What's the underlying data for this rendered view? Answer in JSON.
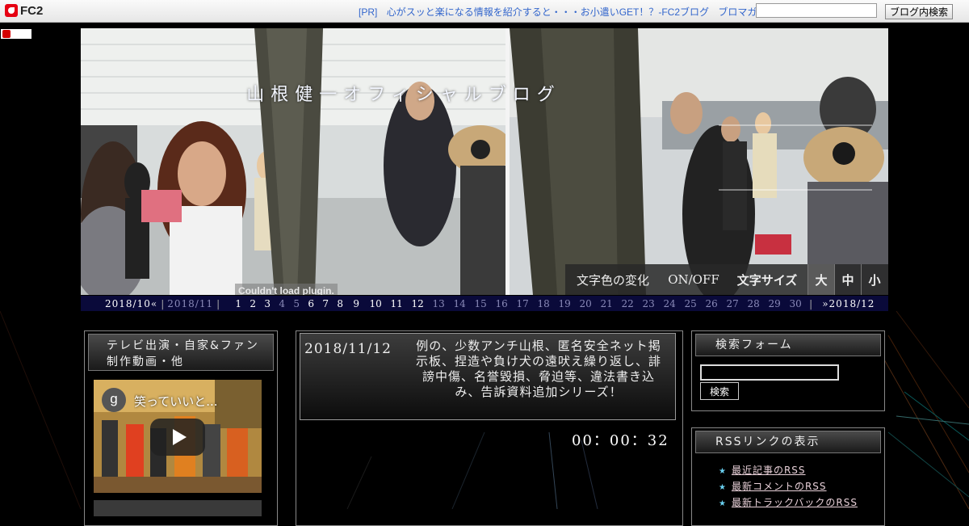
{
  "topbar": {
    "logo": "FC2",
    "pr_tag": "[PR]",
    "pr_text": "心がスッと楽になる情報を紹介すると・・・お小遣いGET！？-FC2ブログ",
    "promaga": "ブロマガ",
    "search_placeholder": "",
    "search_button": "ブログ内検索"
  },
  "header": {
    "blog_title": "山根健一オフィシャルブログ",
    "plugin_error": "Couldn't load plugin.",
    "color_change": "文字色の変化",
    "onoff": "ON/OFF",
    "font_size_label": "文字サイズ",
    "size_large": "大",
    "size_medium": "中",
    "size_small": "小"
  },
  "calendar": {
    "prev": "2018/10«",
    "current": "2018/11",
    "days_with_posts": [
      1,
      2,
      3,
      6,
      7,
      8,
      9,
      10,
      11,
      12
    ],
    "days": [
      1,
      2,
      3,
      4,
      5,
      6,
      7,
      8,
      9,
      10,
      11,
      12,
      13,
      14,
      15,
      16,
      17,
      18,
      19,
      20,
      21,
      22,
      23,
      24,
      25,
      26,
      27,
      28,
      29,
      30
    ],
    "next": "»2018/12"
  },
  "left_sidebar": {
    "heading": "テレビ出演・自家&ファン制作動画・他",
    "video_channel_initial": "g",
    "video_title": "笑っていいと..."
  },
  "entry": {
    "date": "2018/11/12",
    "title": "例の、少数アンチ山根、匿名安全ネット掲示板、捏造や負け犬の遠吠え繰り返し、誹謗中傷、名誉毀損、脅迫等、違法書き込み、告訴資料追加シリーズ！",
    "clock": "00：00：32"
  },
  "right_sidebar": {
    "search_heading": "検索フォーム",
    "search_value": "",
    "search_button": "検索",
    "rss_heading": "RSSリンクの表示",
    "rss_links": [
      "最近記事のRSS",
      "最新コメントのRSS",
      "最新トラックバックのRSS"
    ]
  },
  "colors": {
    "calendar_bg": "#0a0a3a",
    "link_blue": "#3366cc",
    "background": "#000000"
  }
}
